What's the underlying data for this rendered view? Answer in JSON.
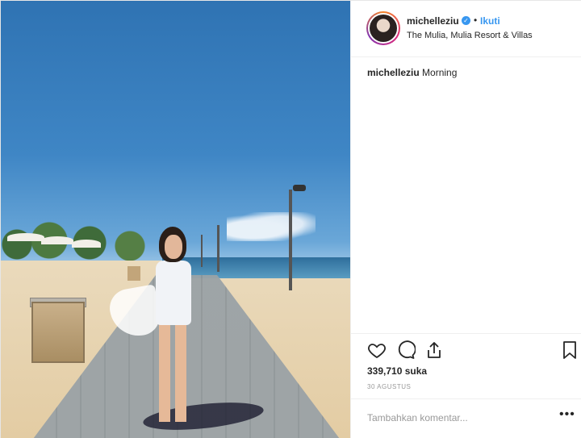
{
  "post": {
    "author": {
      "username": "michelleziu",
      "verified": true,
      "follow_label": "Ikuti",
      "separator": "•"
    },
    "location": "The Mulia, Mulia Resort & Villas",
    "caption": {
      "username": "michelleziu",
      "text": "Morning"
    },
    "likes": "339,710 suka",
    "date": "30 AGUSTUS",
    "comment": {
      "placeholder": "Tambahkan komentar...",
      "more": "•••"
    },
    "icons": [
      "heart-icon",
      "comment-icon",
      "share-icon",
      "bookmark-icon"
    ]
  },
  "colors": {
    "accent": "#3897f0",
    "text": "#262626",
    "muted": "#999999",
    "border": "#efefef"
  }
}
